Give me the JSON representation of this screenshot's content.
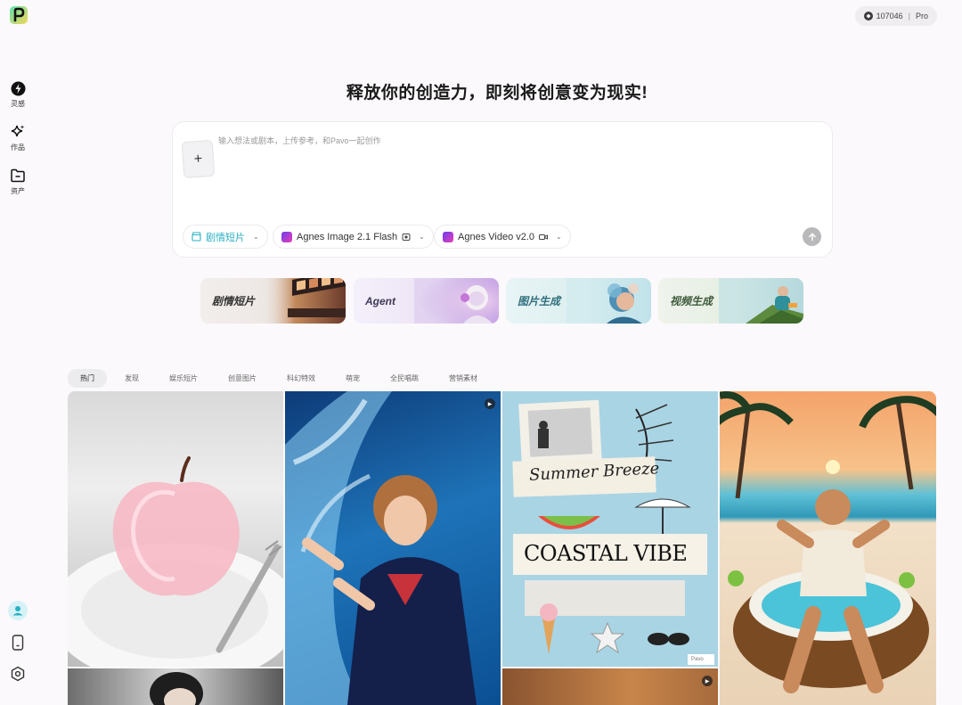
{
  "sidebar": {
    "items": [
      {
        "label": "灵感",
        "icon": "lightning-icon"
      },
      {
        "label": "作品",
        "icon": "sparkle-icon"
      },
      {
        "label": "资产",
        "icon": "folder-icon"
      }
    ]
  },
  "credits": {
    "amount": "107046",
    "separator": "|",
    "plan": "Pro"
  },
  "headline": "释放你的创造力，即刻将创意变为现实!",
  "prompt": {
    "placeholder": "输入想法或剧本，上传参考，和Pavo一起创作",
    "upload_label": "+",
    "chips": [
      {
        "label": "剧情短片"
      },
      {
        "label": "Agnes Image 2.1 Flash"
      },
      {
        "label": "Agnes Video v2.0"
      }
    ]
  },
  "features": [
    {
      "label": "剧情短片"
    },
    {
      "label": "Agent"
    },
    {
      "label": "图片生成"
    },
    {
      "label": "视频生成"
    }
  ],
  "tabs": [
    "热门",
    "发现",
    "娱乐短片",
    "创意图片",
    "科幻特效",
    "萌宠",
    "全民唱跳",
    "营销素材"
  ],
  "gallery": {
    "poster": {
      "script_title": "Summer Breeze",
      "main_title": "COASTAL VIBE",
      "watermark": "Pavo"
    }
  },
  "colors": {
    "accent_teal": "#2bb0c4",
    "brand_gradient_start": "#6a3df0",
    "brand_gradient_end": "#e93fb5"
  }
}
